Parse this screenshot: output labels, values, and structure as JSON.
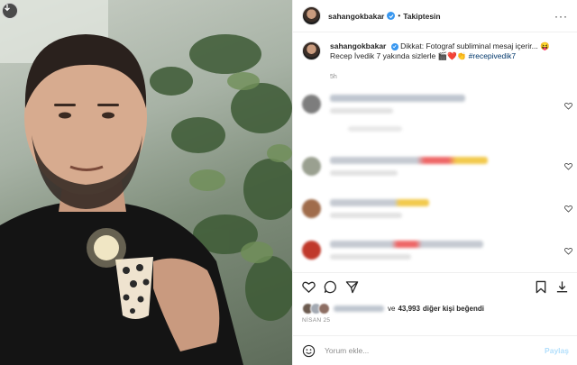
{
  "header": {
    "username": "sahangokbakar",
    "separator": "•",
    "follow_status": "Takiptesin"
  },
  "caption": {
    "username": "sahangokbakar",
    "text": "Dikkat: Fotograf subliminal mesaj içerir... 😝",
    "line2": "Recep İvedik 7 yakında sizlerle 🎬❤️👏",
    "hashtag": "#recepivedik7",
    "time": "5h"
  },
  "actions": {
    "like_icon": "heart-icon",
    "comment_icon": "comment-icon",
    "share_icon": "share-icon",
    "save_icon": "bookmark-icon",
    "download_icon": "download-icon"
  },
  "likes": {
    "prefix": "ve",
    "count": "43,993",
    "suffix": "diğer kişi beğendi"
  },
  "post_date": "NİSAN 25",
  "comment_box": {
    "placeholder": "Yorum ekle...",
    "post_label": "Paylaş"
  },
  "colors": {
    "accent": "#0095f6",
    "verified": "#3897f0",
    "muted": "#8e8e8e",
    "border": "#efefef"
  }
}
